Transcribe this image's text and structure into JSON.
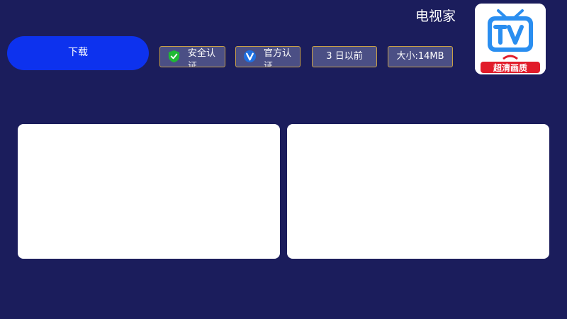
{
  "app": {
    "title": "电视家",
    "icon_name": "tv-app-logo-icon",
    "icon_caption": "超清画质"
  },
  "actions": {
    "download_label": "下载"
  },
  "badges": {
    "security": {
      "label": "安全认证",
      "icon": "shield-check-icon"
    },
    "official": {
      "label": "官方认证",
      "icon": "verified-v-icon"
    },
    "updated": {
      "label": "3 日以前"
    },
    "size": {
      "label": "大小:14MB"
    }
  },
  "screenshots": {
    "count": 2
  },
  "colors": {
    "background": "#1b1d5c",
    "download_button": "#0d32ee",
    "badge_background": "#4b4f85",
    "badge_border": "#c8a047",
    "icon_blue": "#2a8ef0",
    "icon_caption_red": "#e11c2a",
    "shield_green": "#1fb935"
  }
}
